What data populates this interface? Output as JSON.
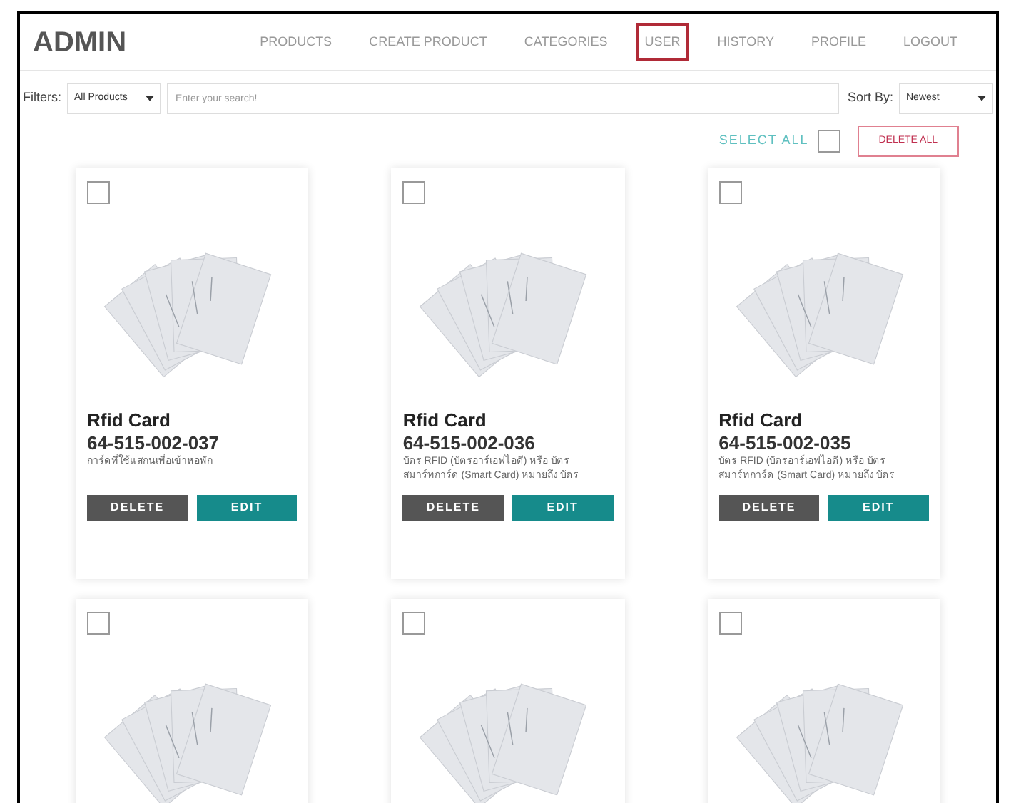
{
  "header": {
    "title": "ADMIN",
    "nav": [
      {
        "label": "PRODUCTS",
        "selected": false
      },
      {
        "label": "CREATE PRODUCT",
        "selected": false
      },
      {
        "label": "CATEGORIES",
        "selected": false
      },
      {
        "label": "USER",
        "selected": true
      },
      {
        "label": "HISTORY",
        "selected": false
      },
      {
        "label": "PROFILE",
        "selected": false
      },
      {
        "label": "LOGOUT",
        "selected": false
      }
    ]
  },
  "filters": {
    "label": "Filters:",
    "category": "All Products",
    "search_placeholder": "Enter your search!",
    "sort_label": "Sort By:",
    "sort": "Newest"
  },
  "bulk": {
    "select_all": "SELECT ALL",
    "select_all_checked": false,
    "delete_all": "DELETE ALL"
  },
  "products": [
    {
      "name": "Rfid Card",
      "code": "64-515-002-037",
      "description": [
        "การ์ดที่ใช้แสกนเพื่อเข้าหอพัก"
      ],
      "checked": false,
      "delete": "DELETE",
      "edit": "EDIT"
    },
    {
      "name": "Rfid Card",
      "code": "64-515-002-036",
      "description": [
        "บัตร RFID (บัตรอาร์เอฟไอดี) หรือ บัตร",
        "สมาร์ทการ์ด (Smart Card) หมายถึง บัตร"
      ],
      "checked": false,
      "delete": "DELETE",
      "edit": "EDIT"
    },
    {
      "name": "Rfid Card",
      "code": "64-515-002-035",
      "description": [
        "บัตร RFID (บัตรอาร์เอฟไอดี) หรือ บัตร",
        "สมาร์ทการ์ด (Smart Card) หมายถึง บัตร"
      ],
      "checked": false,
      "delete": "DELETE",
      "edit": "EDIT"
    },
    {
      "checked": false
    },
    {
      "checked": false
    },
    {
      "checked": false
    }
  ]
}
